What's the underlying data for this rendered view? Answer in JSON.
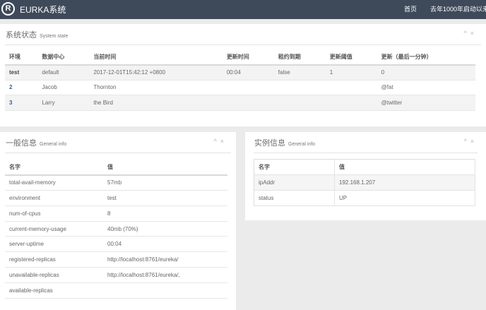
{
  "app": {
    "logo_letter": "R",
    "title": "EURKA系统",
    "nav_home": "首页",
    "nav_uptime": "去年1000年启动以来"
  },
  "system_state": {
    "title": "系统状态",
    "subtitle": "System state",
    "columns": [
      "环境",
      "数据中心",
      "当前时间",
      "更新时间",
      "租约到期",
      "更新阈值",
      "更新（最后一分钟）"
    ],
    "rows": [
      [
        "test",
        "default",
        "2017-12-01T15:42:12 +0800",
        "00:04",
        "false",
        "1",
        "0"
      ],
      [
        "2",
        "Jacob",
        "Thornton",
        "",
        "",
        "",
        "@fat"
      ],
      [
        "3",
        "Larry",
        "the Bird",
        "",
        "",
        "",
        "@twitter"
      ]
    ]
  },
  "general_info": {
    "title": "一般信息",
    "subtitle": "General info",
    "columns": [
      "名字",
      "值"
    ],
    "rows": [
      [
        "total-avail-memory",
        "57mb"
      ],
      [
        "environment",
        "test"
      ],
      [
        "num-of-cpus",
        "8"
      ],
      [
        "current-memory-usage",
        "40mb (70%)"
      ],
      [
        "server-uptime",
        "00:04"
      ],
      [
        "registered-replicas",
        "http://localhost:8761/eureka/"
      ],
      [
        "unavailable-replicas",
        "http://localhost:8761/eureka/,"
      ],
      [
        "available-replicas",
        ""
      ]
    ]
  },
  "instance_info": {
    "title": "实例信息",
    "subtitle": "General info",
    "columns": [
      "名字",
      "值"
    ],
    "rows": [
      [
        "ipAddr",
        "192.168.1.207"
      ],
      [
        "status",
        "UP"
      ]
    ]
  },
  "panel_tools": {
    "collapse_icon": "^",
    "close_icon": "×"
  },
  "icons": {
    "logo": "registered-logo-icon",
    "collapse": "chevron-up-icon",
    "close": "close-icon"
  },
  "colors": {
    "topbar": "#3e4a5a",
    "background": "#ebebeb",
    "link": "#3b5d8f"
  }
}
